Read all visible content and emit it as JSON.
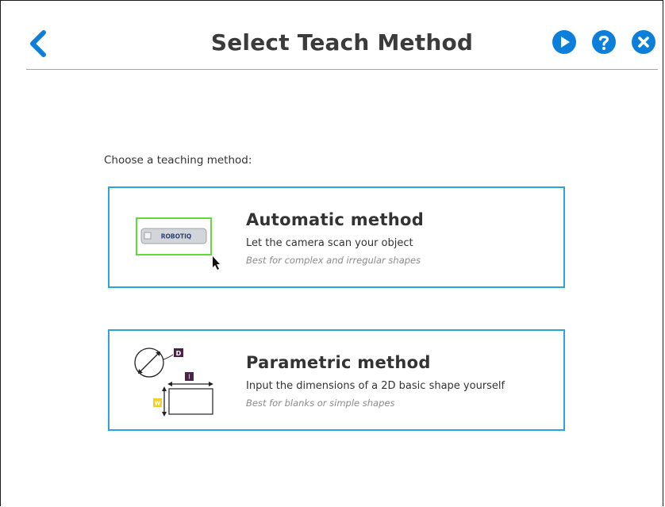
{
  "header": {
    "title": "Select Teach Method",
    "icons": {
      "back": "chevron-left-icon",
      "play": "play-icon",
      "help": "help-icon",
      "close": "close-icon"
    }
  },
  "prompt": "Choose a teaching method:",
  "methods": [
    {
      "title": "Automatic method",
      "description": "Let the camera scan your object",
      "note": "Best for complex and irregular shapes",
      "illustration": {
        "logo_text": "ROBOTIQ"
      }
    },
    {
      "title": "Parametric method",
      "description": "Input the dimensions of a 2D basic shape yourself",
      "note": "Best for blanks or simple shapes",
      "illustration": {
        "diameter_label": "D",
        "length_label": "l",
        "width_label": "W"
      }
    }
  ],
  "colors": {
    "accent": "#0b7fd9",
    "card_border": "#2aa5df",
    "scan_box": "#5ddc3a",
    "label_purple": "#4a2348",
    "label_yellow": "#f3cf2b"
  }
}
